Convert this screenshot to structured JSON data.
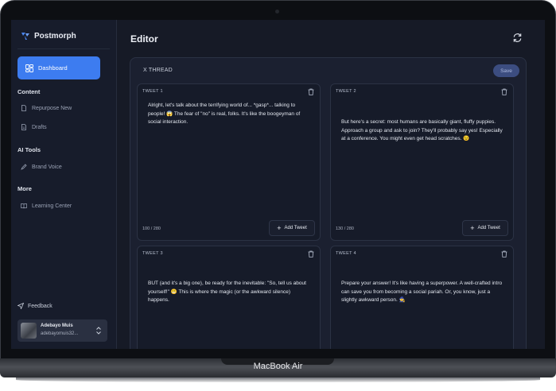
{
  "device": {
    "label": "MacBook Air"
  },
  "brand": {
    "name": "Postmorph"
  },
  "sidebar": {
    "dashboard_label": "Dashboard",
    "sections": {
      "content": "Content",
      "ai_tools": "AI Tools",
      "more": "More"
    },
    "items": {
      "repurpose": "Repurpose New",
      "drafts": "Drafts",
      "brand_voice": "Brand Voice",
      "learning": "Learning Center"
    },
    "feedback_label": "Feedback",
    "user": {
      "name": "Adebayo Muis",
      "email": "adebayomuis32..."
    }
  },
  "main": {
    "title": "Editor",
    "panel_title": "X THREAD",
    "save_label": "Save",
    "add_label": "Add Tweet",
    "tweets": [
      {
        "label": "TWEET 1",
        "text": "Alright, let's talk about the terrifying world of... *gasp*... talking to people! 😱 The fear of \"no\" is real, folks. It's like the boogeyman of social interaction.",
        "count": "100 / 280"
      },
      {
        "label": "TWEET 2",
        "text": "But here's a secret: most humans are basically giant, fluffy puppies. Approach a group and ask to join? They'll probably say yes! Especially at a conference. You might even get head scratches. 😉",
        "count": "130 / 280"
      },
      {
        "label": "TWEET 3",
        "text": "BUT (and it's a big one), be ready for the inevitable: \"So, tell us about yourself!\" 😬 This is where the magic (or the awkward silence) happens."
      },
      {
        "label": "TWEET 4",
        "text": "Prepare your answer! It's like having a superpower. A well-crafted intro can save you from becoming a social pariah. Or, you know, just a slightly awkward person. 🧙"
      }
    ]
  }
}
